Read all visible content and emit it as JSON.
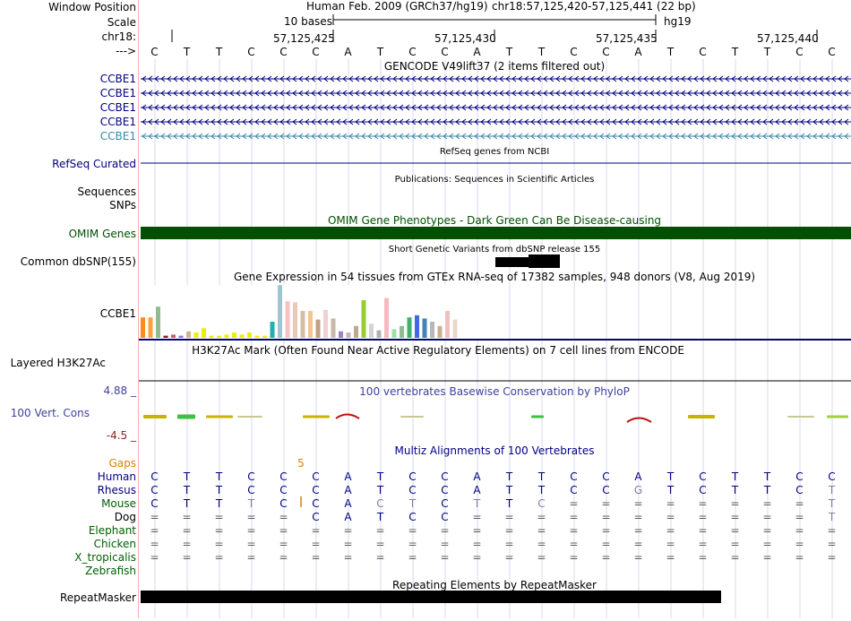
{
  "labels": {
    "window_position": "Window Position",
    "scale": "Scale",
    "chr": "chr18:",
    "arrow": "--->",
    "gencode_tracks": [
      "CCBE1",
      "CCBE1",
      "CCBE1",
      "CCBE1",
      "CCBE1"
    ],
    "refseq": "RefSeq Curated",
    "sequences": "Sequences",
    "snps": "SNPs",
    "omim": "OMIM Genes",
    "common_dbsnp": "Common dbSNP(155)",
    "gtex_gene": "CCBE1",
    "h3k27ac": "Layered H3K27Ac",
    "cons_top": "4.88 _",
    "cons_name": "100 Vert. Cons",
    "cons_bottom": "-4.5 _",
    "gaps": "Gaps",
    "species": [
      "Human",
      "Rhesus",
      "Mouse",
      "Dog",
      "Elephant",
      "Chicken",
      "X_tropicalis",
      "Zebrafish"
    ],
    "repeatmasker": "RepeatMasker"
  },
  "header": {
    "assembly": "Human Feb. 2009 (GRCh37/hg19)",
    "position": "chr18:57,125,420-57,125,441 (22 bp)",
    "scale_text": "10 bases",
    "scale_db": "hg19",
    "coords": [
      "57,125,425",
      "57,125,430",
      "57,125,435",
      "57,125,440"
    ]
  },
  "bases": [
    "C",
    "T",
    "T",
    "C",
    "C",
    "C",
    "A",
    "T",
    "C",
    "C",
    "A",
    "T",
    "T",
    "C",
    "C",
    "A",
    "T",
    "C",
    "T",
    "T",
    "C",
    "C"
  ],
  "titles": {
    "gencode": "GENCODE V49lift37 (2 items filtered out)",
    "refseq": "RefSeq genes from NCBI",
    "publications": "Publications: Sequences in Scientific Articles",
    "omim": "OMIM Gene Phenotypes - Dark Green Can Be Disease-causing",
    "dbsnp": "Short Genetic Variants from dbSNP release 155",
    "gtex": "Gene Expression in 54 tissues from GTEx RNA-seq of 17382 samples, 948 donors (V8, Aug 2019)",
    "h3k27ac": "H3K27Ac Mark (Often Found Near Active Regulatory Elements) on 7 cell lines from ENCODE",
    "phylop": "100 vertebrates Basewise Conservation by PhyloP",
    "multiz": "Multiz Alignments of 100 Vertebrates",
    "repeat": "Repeating Elements by RepeatMasker"
  },
  "gaps_value": "5",
  "alignment": {
    "Human": [
      "C",
      "T",
      "T",
      "C",
      "C",
      "C",
      "A",
      "T",
      "C",
      "C",
      "A",
      "T",
      "T",
      "C",
      "C",
      "A",
      "T",
      "C",
      "T",
      "T",
      "C",
      "C"
    ],
    "Rhesus": [
      "C",
      "T",
      "T",
      "C",
      "C",
      "C",
      "A",
      "T",
      "C",
      "C",
      "A",
      "T",
      "T",
      "C",
      "C",
      "G",
      "T",
      "C",
      "T",
      "T",
      "C",
      "T"
    ],
    "Mouse": [
      "C",
      "T",
      "T",
      "T",
      "C",
      "C",
      "A",
      "C",
      "T",
      "C",
      "T",
      "T",
      "C",
      "=",
      "=",
      "=",
      "=",
      "=",
      "=",
      "=",
      "=",
      "T"
    ],
    "Dog": [
      "=",
      "=",
      "=",
      "=",
      "=",
      "C",
      "A",
      "T",
      "C",
      "C",
      "=",
      "=",
      "=",
      "=",
      "=",
      "=",
      "=",
      "=",
      "=",
      "=",
      "=",
      "T"
    ],
    "Elephant": [
      "=",
      "=",
      "=",
      "=",
      "=",
      "=",
      "=",
      "=",
      "=",
      "=",
      "=",
      "=",
      "=",
      "=",
      "=",
      "=",
      "=",
      "=",
      "=",
      "=",
      "=",
      "="
    ],
    "Chicken": [
      "=",
      "=",
      "=",
      "=",
      "=",
      "=",
      "=",
      "=",
      "=",
      "=",
      "=",
      "=",
      "=",
      "=",
      "=",
      "=",
      "=",
      "=",
      "=",
      "=",
      "=",
      "="
    ],
    "X_tropicalis": [
      "=",
      "=",
      "=",
      "=",
      "=",
      "=",
      "=",
      "=",
      "=",
      "=",
      "=",
      "=",
      "=",
      "=",
      "=",
      "=",
      "=",
      "=",
      "=",
      "=",
      "=",
      "="
    ],
    "Zebrafish": []
  },
  "gtex_bars": [
    {
      "v": 0.38,
      "c": "#ff8c1a"
    },
    {
      "v": 0.38,
      "c": "#ffa040"
    },
    {
      "v": 0.58,
      "c": "#8fbc8f"
    },
    {
      "v": 0.04,
      "c": "#8b1a1a"
    },
    {
      "v": 0.06,
      "c": "#cd5c5c"
    },
    {
      "v": 0.04,
      "c": "#9370db"
    },
    {
      "v": 0.12,
      "c": "#d2b48c"
    },
    {
      "v": 0.1,
      "c": "#eeee00"
    },
    {
      "v": 0.18,
      "c": "#eeee00"
    },
    {
      "v": 0.04,
      "c": "#eeee00"
    },
    {
      "v": 0.04,
      "c": "#eeee00"
    },
    {
      "v": 0.06,
      "c": "#eeee00"
    },
    {
      "v": 0.1,
      "c": "#eeee00"
    },
    {
      "v": 0.06,
      "c": "#eeee00"
    },
    {
      "v": 0.1,
      "c": "#eeee00"
    },
    {
      "v": 0.04,
      "c": "#eeee00"
    },
    {
      "v": 0.04,
      "c": "#eeee00"
    },
    {
      "v": 0.3,
      "c": "#20b2aa"
    },
    {
      "v": 0.98,
      "c": "#a0c4d0"
    },
    {
      "v": 0.68,
      "c": "#f4c2c2"
    },
    {
      "v": 0.66,
      "c": "#e8c8b8"
    },
    {
      "v": 0.5,
      "c": "#d3c0a0"
    },
    {
      "v": 0.5,
      "c": "#f4c48c"
    },
    {
      "v": 0.34,
      "c": "#c0a080"
    },
    {
      "v": 0.52,
      "c": "#f0d0d0"
    },
    {
      "v": 0.36,
      "c": "#c8b8a8"
    },
    {
      "v": 0.12,
      "c": "#a080c0"
    },
    {
      "v": 0.1,
      "c": "#c0b8b8"
    },
    {
      "v": 0.22,
      "c": "#c0a890"
    },
    {
      "v": 0.7,
      "c": "#9acd32"
    },
    {
      "v": 0.26,
      "c": "#d3d3d3"
    },
    {
      "v": 0.14,
      "c": "#b0b0b0"
    },
    {
      "v": 0.74,
      "c": "#f8b8c0"
    },
    {
      "v": 0.16,
      "c": "#a0e0a0"
    },
    {
      "v": 0.22,
      "c": "#8fbc8f"
    },
    {
      "v": 0.38,
      "c": "#3cb371"
    },
    {
      "v": 0.42,
      "c": "#4169e1"
    },
    {
      "v": 0.36,
      "c": "#4682b4"
    },
    {
      "v": 0.3,
      "c": "#b8b8b8"
    },
    {
      "v": 0.22,
      "c": "#c8b090"
    },
    {
      "v": 0.5,
      "c": "#f0c0c0"
    },
    {
      "v": 0.34,
      "c": "#e8d8c8"
    }
  ],
  "colors": {
    "blue_label": "#000080",
    "teal_label": "#3888a8",
    "omim_green": "#005000",
    "phylop_blue": "#4040a0",
    "gaps_orange": "#e08000",
    "species_green": "#006000",
    "grid": "#d8d8ec"
  }
}
